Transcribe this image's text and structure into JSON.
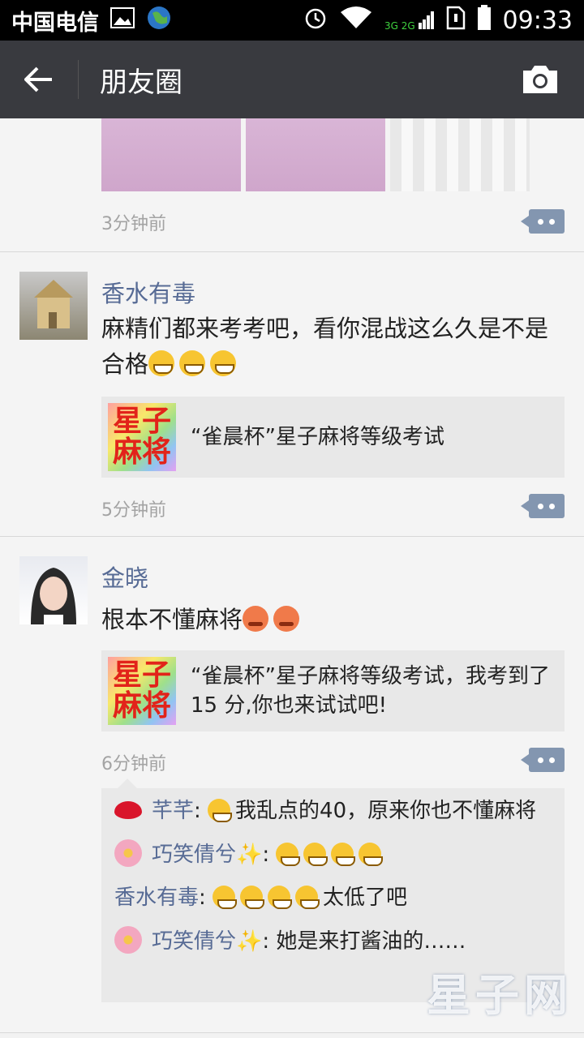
{
  "status_bar": {
    "carrier": "中国电信",
    "network": "3G 2G",
    "time": "09:33"
  },
  "app_bar": {
    "title": "朋友圈"
  },
  "posts": [
    {
      "time": "3分钟前"
    },
    {
      "name": "香水有毒",
      "text": "麻精们都来考考吧，看你混战这么久是不是合格",
      "link_thumb_line1": "星子",
      "link_thumb_line2": "麻将",
      "link_title": "“雀晨杯”星子麻将等级考试",
      "time": "5分钟前"
    },
    {
      "name": "金晓",
      "text": "根本不懂麻将",
      "link_thumb_line1": "星子",
      "link_thumb_line2": "麻将",
      "link_title": "“雀晨杯”星子麻将等级考试，我考到了 15 分,你也来试试吧!",
      "time": "6分钟前",
      "comments": [
        {
          "name": "芊芊",
          "text": "我乱点的40，原来你也不懂麻将"
        },
        {
          "name": "巧笑倩兮",
          "sparkle": "✨",
          "text": ""
        },
        {
          "name": "香水有毒",
          "text": "太低了吧"
        },
        {
          "name": "巧笑倩兮",
          "sparkle": "✨",
          "text": "她是来打酱油的……"
        }
      ]
    }
  ],
  "watermark": "星子网",
  "colors": {
    "link_name": "#576b95",
    "app_bar": "#393a3f"
  }
}
